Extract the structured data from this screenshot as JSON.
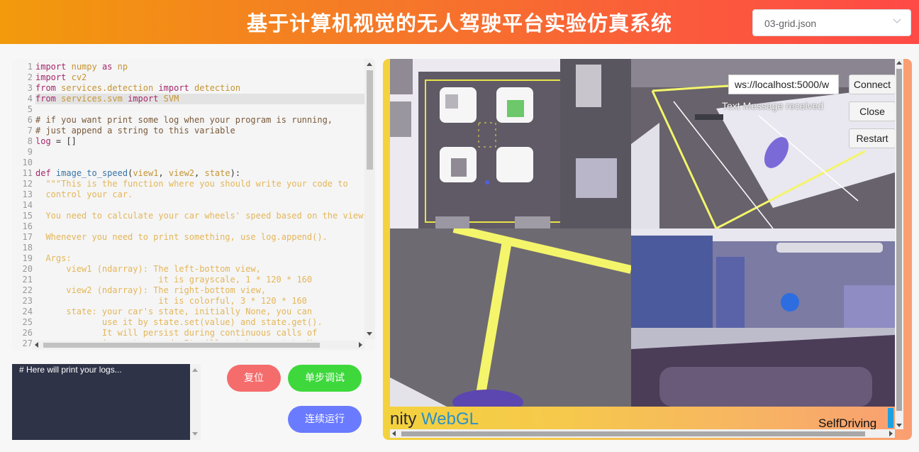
{
  "header": {
    "title": "基于计算机视觉的无人驾驶平台实验仿真系统",
    "select_value": "03-grid.json"
  },
  "editor": {
    "line_numbers": [
      "1",
      "2",
      "3",
      "4",
      "5",
      "6",
      "7",
      "8",
      "9",
      "10",
      "11",
      "12",
      "13",
      "14",
      "15",
      "16",
      "17",
      "18",
      "19",
      "20",
      "21",
      "22",
      "23",
      "24",
      "25",
      "26",
      "27"
    ],
    "highlighted_line": 4,
    "lines": [
      [
        {
          "t": "import",
          "c": "kw"
        },
        {
          "t": " "
        },
        {
          "t": "numpy",
          "c": "md"
        },
        {
          "t": " "
        },
        {
          "t": "as",
          "c": "kw"
        },
        {
          "t": " "
        },
        {
          "t": "np",
          "c": "md"
        }
      ],
      [
        {
          "t": "import",
          "c": "kw"
        },
        {
          "t": " "
        },
        {
          "t": "cv2",
          "c": "md"
        }
      ],
      [
        {
          "t": "from",
          "c": "kw"
        },
        {
          "t": " "
        },
        {
          "t": "services.detection",
          "c": "md"
        },
        {
          "t": " "
        },
        {
          "t": "import",
          "c": "kw"
        },
        {
          "t": " "
        },
        {
          "t": "detection",
          "c": "md"
        }
      ],
      [
        {
          "t": "from",
          "c": "kw"
        },
        {
          "t": " "
        },
        {
          "t": "services.svm",
          "c": "md"
        },
        {
          "t": " "
        },
        {
          "t": "import",
          "c": "kw"
        },
        {
          "t": " "
        },
        {
          "t": "SVM",
          "c": "md"
        }
      ],
      [],
      [
        {
          "t": "# if you want print some log when your program is running,",
          "c": "cm"
        }
      ],
      [
        {
          "t": "# just append a string to this variable",
          "c": "cm"
        }
      ],
      [
        {
          "t": "log",
          "c": "kw"
        },
        {
          "t": " = []"
        }
      ],
      [],
      [],
      [
        {
          "t": "def",
          "c": "kw"
        },
        {
          "t": " "
        },
        {
          "t": "image_to_speed",
          "c": "fn"
        },
        {
          "t": "("
        },
        {
          "t": "view1",
          "c": "md"
        },
        {
          "t": ", "
        },
        {
          "t": "view2",
          "c": "md"
        },
        {
          "t": ", "
        },
        {
          "t": "state",
          "c": "md"
        },
        {
          "t": "):"
        }
      ],
      [
        {
          "t": "  \"\"\"This is the function where you should write your code to",
          "c": "st"
        }
      ],
      [
        {
          "t": "  control your car.",
          "c": "st"
        }
      ],
      [],
      [
        {
          "t": "  You need to calculate your car wheels' speed based on the views.",
          "c": "st"
        }
      ],
      [],
      [
        {
          "t": "  Whenever you need to print something, use log.append().",
          "c": "st"
        }
      ],
      [],
      [
        {
          "t": "  Args:",
          "c": "st"
        }
      ],
      [
        {
          "t": "      view1 (ndarray): The left-bottom view,",
          "c": "st"
        }
      ],
      [
        {
          "t": "                        it is grayscale, 1 * 120 * 160",
          "c": "st"
        }
      ],
      [
        {
          "t": "      view2 (ndarray): The right-bottom view,",
          "c": "st"
        }
      ],
      [
        {
          "t": "                        it is colorful, 3 * 120 * 160",
          "c": "st"
        }
      ],
      [
        {
          "t": "      state: your car's state, initially None, you can",
          "c": "st"
        }
      ],
      [
        {
          "t": "             use it by state.set(value) and state.get().",
          "c": "st"
        }
      ],
      [
        {
          "t": "             It will persist during continuous calls of",
          "c": "st"
        }
      ],
      [
        {
          "t": "             image_to_speed. It will not be reset to None",
          "c": "st"
        }
      ]
    ]
  },
  "log": {
    "text": "# Here will print your logs..."
  },
  "buttons": {
    "reset": "复位",
    "step": "单步调试",
    "run": "连续运行"
  },
  "unity": {
    "ws_url": "ws://localhost:5000/w",
    "connect": "Connect",
    "close": "Close",
    "restart": "Restart",
    "message": "Text Message received",
    "logo_unity": "nity",
    "logo_webgl": "WebGL",
    "product": "SelfDriving"
  },
  "colors": {
    "header_gradient": [
      "#f29a0c",
      "#ff4a46"
    ],
    "reset_button": "#f56c6c",
    "step_button": "#3ed83c",
    "run_button": "#6a7bff",
    "log_background": "#2e3347",
    "road_line": "#f4f56a"
  }
}
